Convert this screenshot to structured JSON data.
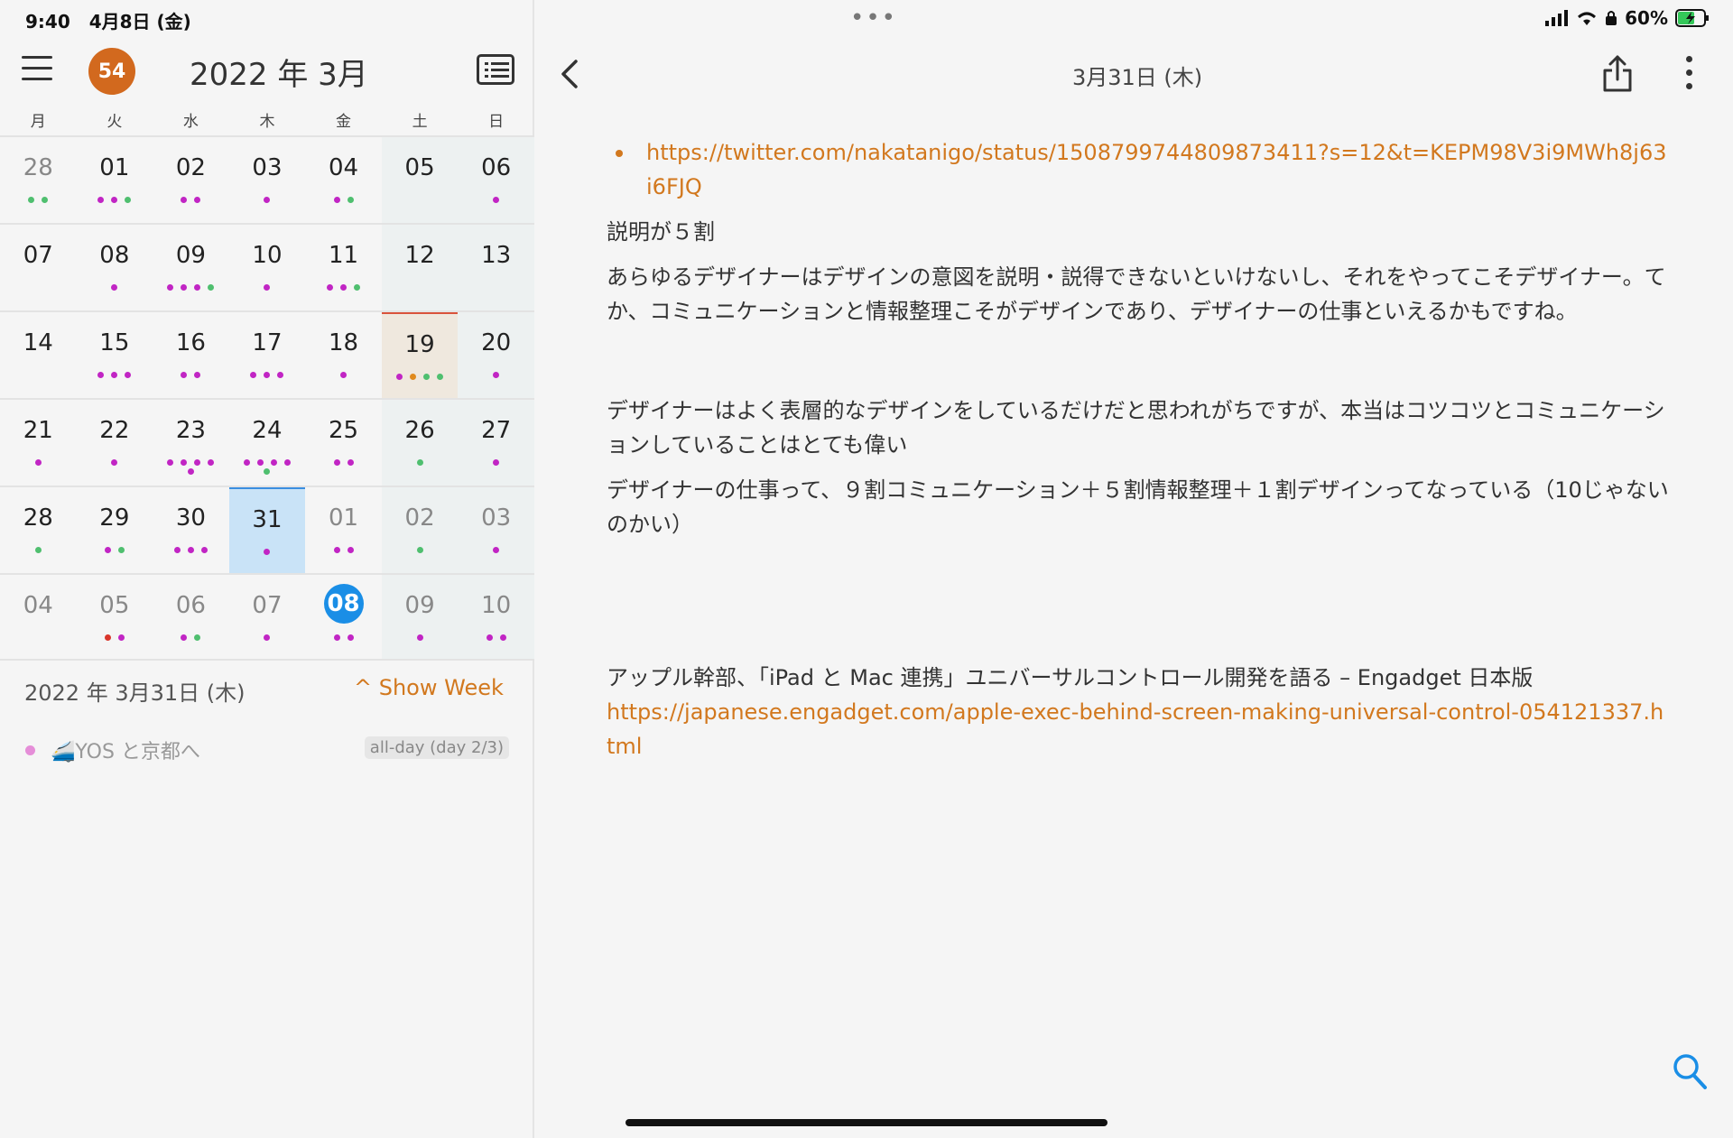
{
  "status_bar": {
    "time": "9:40",
    "date": "4月8日 (金)",
    "battery": "60%"
  },
  "calendar": {
    "badge_count": "54",
    "month_title": "2022 年 3月",
    "weekdays": [
      "月",
      "火",
      "水",
      "木",
      "金",
      "土",
      "日"
    ],
    "weeks": [
      [
        {
          "n": "28",
          "other": true,
          "dots": [
            "#4fbf6f",
            "#4fbf6f"
          ]
        },
        {
          "n": "01",
          "dots": [
            "#c125c4",
            "#c125c4",
            "#4fbf6f"
          ]
        },
        {
          "n": "02",
          "dots": [
            "#c125c4",
            "#c125c4"
          ]
        },
        {
          "n": "03",
          "dots": [
            "#c125c4"
          ]
        },
        {
          "n": "04",
          "dots": [
            "#c125c4",
            "#4fbf6f"
          ]
        },
        {
          "n": "05",
          "weekend": true,
          "dots": []
        },
        {
          "n": "06",
          "weekend": true,
          "dots": [
            "#c125c4"
          ]
        }
      ],
      [
        {
          "n": "07",
          "dots": []
        },
        {
          "n": "08",
          "dots": [
            "#c125c4"
          ]
        },
        {
          "n": "09",
          "dots": [
            "#c125c4",
            "#c125c4",
            "#c125c4",
            "#4fbf6f"
          ]
        },
        {
          "n": "10",
          "dots": [
            "#c125c4"
          ]
        },
        {
          "n": "11",
          "dots": [
            "#c125c4",
            "#c125c4",
            "#4fbf6f"
          ]
        },
        {
          "n": "12",
          "weekend": true,
          "dots": []
        },
        {
          "n": "13",
          "weekend": true,
          "dots": []
        }
      ],
      [
        {
          "n": "14",
          "dots": []
        },
        {
          "n": "15",
          "dots": [
            "#c125c4",
            "#c125c4",
            "#c125c4"
          ]
        },
        {
          "n": "16",
          "dots": [
            "#c125c4",
            "#c125c4"
          ]
        },
        {
          "n": "17",
          "dots": [
            "#c125c4",
            "#c125c4",
            "#c125c4"
          ]
        },
        {
          "n": "18",
          "dots": [
            "#c125c4"
          ]
        },
        {
          "n": "19",
          "weekend": true,
          "special": true,
          "dots": [
            "#c125c4",
            "#e08a1e",
            "#4fbf6f",
            "#4fbf6f"
          ]
        },
        {
          "n": "20",
          "weekend": true,
          "dots": [
            "#c125c4"
          ]
        }
      ],
      [
        {
          "n": "21",
          "dots": [
            "#c125c4"
          ]
        },
        {
          "n": "22",
          "dots": [
            "#c125c4"
          ]
        },
        {
          "n": "23",
          "dots": [
            "#c125c4",
            "#c125c4",
            "#c125c4",
            "#c125c4",
            "#c125c4"
          ]
        },
        {
          "n": "24",
          "dots": [
            "#c125c4",
            "#c125c4",
            "#c125c4",
            "#c125c4",
            "#4fbf6f"
          ]
        },
        {
          "n": "25",
          "dots": [
            "#c125c4",
            "#c125c4"
          ]
        },
        {
          "n": "26",
          "weekend": true,
          "dots": [
            "#4fbf6f"
          ]
        },
        {
          "n": "27",
          "weekend": true,
          "dots": [
            "#c125c4"
          ]
        }
      ],
      [
        {
          "n": "28",
          "dots": [
            "#4fbf6f"
          ]
        },
        {
          "n": "29",
          "dots": [
            "#c125c4",
            "#4fbf6f"
          ]
        },
        {
          "n": "30",
          "dots": [
            "#c125c4",
            "#c125c4",
            "#c125c4"
          ]
        },
        {
          "n": "31",
          "selected": true,
          "dots": [
            "#c125c4"
          ]
        },
        {
          "n": "01",
          "other": true,
          "dots": [
            "#c125c4",
            "#c125c4"
          ]
        },
        {
          "n": "02",
          "other": true,
          "weekend": true,
          "dots": [
            "#4fbf6f"
          ]
        },
        {
          "n": "03",
          "other": true,
          "weekend": true,
          "dots": [
            "#c125c4"
          ]
        }
      ],
      [
        {
          "n": "04",
          "other": true,
          "dots": []
        },
        {
          "n": "05",
          "other": true,
          "dots": [
            "#d9362b",
            "#c125c4"
          ]
        },
        {
          "n": "06",
          "other": true,
          "dots": [
            "#c125c4",
            "#4fbf6f"
          ]
        },
        {
          "n": "07",
          "other": true,
          "dots": [
            "#c125c4"
          ]
        },
        {
          "n": "08",
          "today": true,
          "dots": [
            "#c125c4",
            "#c125c4"
          ]
        },
        {
          "n": "09",
          "other": true,
          "weekend": true,
          "dots": [
            "#c125c4"
          ]
        },
        {
          "n": "10",
          "other": true,
          "weekend": true,
          "dots": [
            "#c125c4",
            "#c125c4"
          ]
        }
      ]
    ]
  },
  "day_view": {
    "date_heading": "2022 年 3月31日 (木)",
    "show_week_label": "^ Show Week",
    "event_title": "🚄YOS と京都へ",
    "event_tag": "all-day (day 2/3)"
  },
  "detail": {
    "title": "3月31日 (木)",
    "link1": "https://twitter.com/nakatanigo/status/1508799744809873411?s=12&t=KEPM98V3i9MWh8j63i6FJQ",
    "para1": "説明が５割",
    "para2": "あらゆるデザイナーはデザインの意図を説明・説得できないといけないし、それをやってこそデザイナー。てか、コミュニケーションと情報整理こそがデザインであり、デザイナーの仕事といえるかもですね。",
    "para3": "デザイナーはよく表層的なデザインをしているだけだと思われがちですが、本当はコツコツとコミュニケーションしていることはとても偉い",
    "para4": "デザイナーの仕事って、９割コミュニケーション＋５割情報整理＋１割デザインってなっている（10じゃないのかい）",
    "para5": "アップル幹部、「iPad と Mac 連携」ユニバーサルコントロール開発を語る – Engadget 日本版",
    "link2": "https://japanese.engadget.com/apple-exec-behind-screen-making-universal-control-054121337.html"
  }
}
